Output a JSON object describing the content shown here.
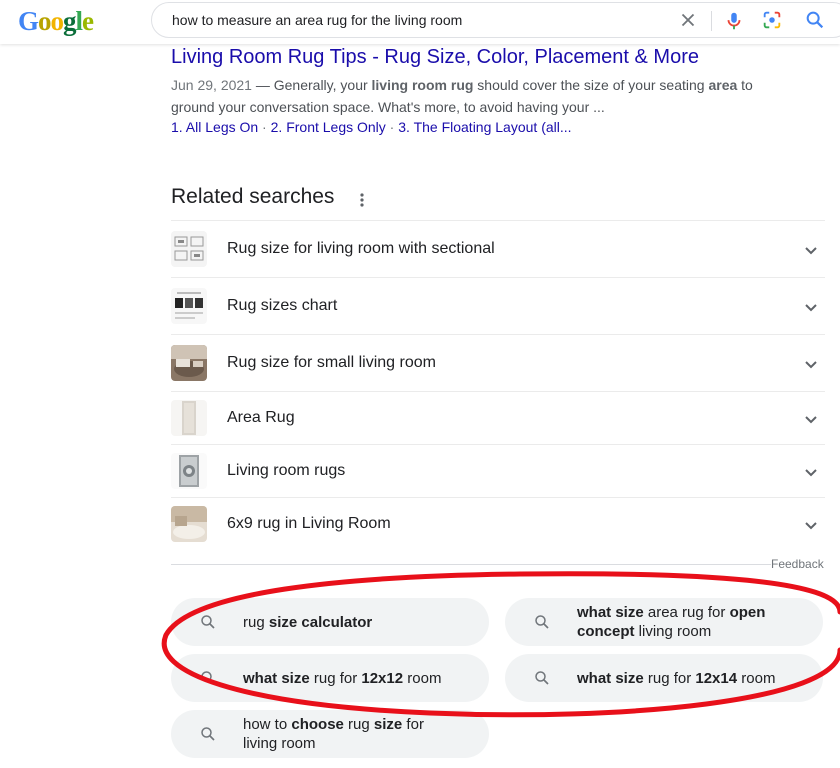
{
  "search": {
    "query": "how to measure an area rug for the living room"
  },
  "result": {
    "title": "Living Room Rug Tips - Rug Size, Color, Placement & More",
    "date": "Jun 29, 2021",
    "dash": " — ",
    "snippet_a": "Generally, your ",
    "snippet_b": "living room rug",
    "snippet_c": " should cover the size of your seating ",
    "snippet_d": "area",
    "snippet_e": " to ground your conversation space. What's more, to avoid having your ...",
    "sitelinks": [
      "1. All Legs On",
      "2. Front Legs Only",
      "3. The Floating Layout (all..."
    ],
    "sitelink_sep": " · "
  },
  "related": {
    "heading": "Related searches",
    "items": [
      {
        "label": "Rug size for living room with sectional"
      },
      {
        "label": "Rug sizes chart"
      },
      {
        "label": "Rug size for small living room"
      },
      {
        "label": "Area Rug"
      },
      {
        "label": "Living room rugs"
      },
      {
        "label": "6x9 rug in Living Room"
      }
    ],
    "feedback": "Feedback"
  },
  "chips": [
    {
      "parts": [
        {
          "t": "rug ",
          "b": false
        },
        {
          "t": "size calculator",
          "b": true
        }
      ]
    },
    {
      "parts": [
        {
          "t": "what size",
          "b": true
        },
        {
          "t": " area rug for ",
          "b": false
        },
        {
          "t": "open concept",
          "b": true
        },
        {
          "t": " living room",
          "b": false
        }
      ]
    },
    {
      "parts": [
        {
          "t": "what size",
          "b": true
        },
        {
          "t": " rug for ",
          "b": false
        },
        {
          "t": "12x12",
          "b": true
        },
        {
          "t": " room",
          "b": false
        }
      ]
    },
    {
      "parts": [
        {
          "t": "what size",
          "b": true
        },
        {
          "t": " rug for ",
          "b": false
        },
        {
          "t": "12x14",
          "b": true
        },
        {
          "t": " room",
          "b": false
        }
      ]
    },
    {
      "parts": [
        {
          "t": "how to ",
          "b": false
        },
        {
          "t": "choose",
          "b": true
        },
        {
          "t": " rug ",
          "b": false
        },
        {
          "t": "size",
          "b": true
        },
        {
          "t": " for living room",
          "b": false
        }
      ]
    }
  ],
  "colors": {
    "link": "#1a0dab",
    "annotation": "#e8101a",
    "chip_bg": "#f1f3f4"
  }
}
